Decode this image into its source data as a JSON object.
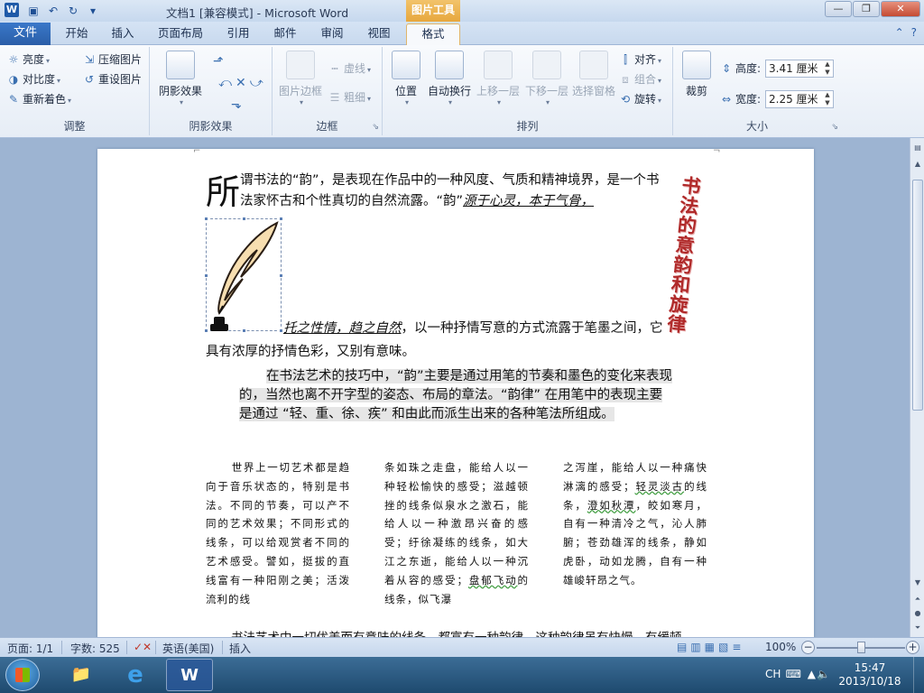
{
  "window": {
    "title": "文档1 [兼容模式] - Microsoft Word",
    "context_tool": "图片工具",
    "app_icon": "W",
    "controls": [
      "—",
      "❐",
      "✕"
    ]
  },
  "tabs": {
    "file": "文件",
    "items": [
      "开始",
      "插入",
      "页面布局",
      "引用",
      "邮件",
      "审阅",
      "视图",
      "格式"
    ],
    "active": "格式"
  },
  "ribbon": {
    "adjust": {
      "label": "调整",
      "brightness": "亮度",
      "contrast": "对比度",
      "recolor": "重新着色",
      "compress": "压缩图片",
      "reset": "重设图片"
    },
    "shadow": {
      "label": "阴影效果",
      "button": "阴影效果"
    },
    "border": {
      "label": "边框",
      "picture_border": "图片边框",
      "dashes": "虚线",
      "weight": "粗细"
    },
    "arrange": {
      "label": "排列",
      "position": "位置",
      "wrap": "自动换行",
      "bring_forward": "上移一层",
      "send_backward": "下移一层",
      "selection_pane": "选择窗格",
      "align": "对齐",
      "group": "组合",
      "rotate": "旋转"
    },
    "size": {
      "label": "大小",
      "crop": "裁剪",
      "height_label": "高度:",
      "height_value": "3.41 厘米",
      "width_label": "宽度:",
      "width_value": "2.25 厘米"
    }
  },
  "document": {
    "dropcap": "所",
    "para1_line1": "谓书法的“韵”，是表现在作品中的一种风度、气质和精神境界，是一个书法家怀古和个性真切的自然流露。“韵”",
    "para1_italic1": "源于心灵，本于气骨，",
    "para1_italic2": "托之性情，趋之自然",
    "para1_rest": "，以一种抒情写意的方式流露于笔墨之间，它具有浓厚的抒情色彩，又别有意味。",
    "vertical_title": "书法的意韵和旋律",
    "para2": "在书法艺术的技巧中，“韵”主要是通过用笔的节奏和墨色的变化来表现的，当然也离不开字型的姿态、布局的章法。“韵律” 在用笔中的表现主要是通过 “轻、重、徐、疾” 和由此而派生出来的各种笔法所组成。",
    "col1": "世界上一切艺术都是趋向于音乐状态的，特别是书法。不同的节奏，可以产不同的艺术效果；不同形式的线条，可以给观赏者不同的艺术感受。譬如，挺拔的直线富有一种阳刚之美；活泼流利的线",
    "col2_a": "条如珠之走盘，能给人以一种轻松愉快的感受；滋越顿挫的线条似泉水之激石，能给人以一种激昂兴奋的感受；纡徐凝练的线条，如大江之东逝，能给人以一种沉着从容的感受；",
    "col2_wavy": "盘郁飞动",
    "col2_b": "的线条，似飞瀑",
    "col3_a": "之泻崖，能给人以一种痛快淋漓的感受；",
    "col3_wavy1": "轻灵淡古",
    "col3_b": "的线条，",
    "col3_wavy2": "澄如秋潭",
    "col3_c": "，皎如寒月，自有一种清冷之气，沁人肺腑；苍劲雄浑的线条，静如虎卧，动如龙腾，自有一种雄峻轩昂之气。",
    "last_line": "书法艺术中一切优美而有意味的线条，都富有一种韵律，这种韵律虽有快慢、有缓顿"
  },
  "statusbar": {
    "page": "页面: 1/1",
    "words": "字数: 525",
    "language": "英语(美国)",
    "insert": "插入",
    "zoom": "100%"
  },
  "taskbar": {
    "ime": "CH",
    "time": "15:47",
    "date": "2013/10/18"
  }
}
